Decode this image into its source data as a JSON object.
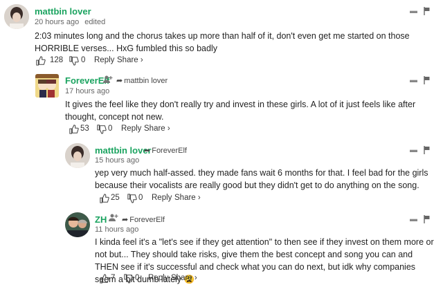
{
  "comments": [
    {
      "name": "mattbin lover",
      "time": "20 hours ago",
      "edited": "edited",
      "text": "2:03 minutes long and the chorus takes up more than half of it, don't even get me started on those HORRIBLE verses... HxG fumbled this so badly",
      "likes": "128",
      "dislikes": "0",
      "reply_label": "Reply",
      "share_label": "Share ›"
    },
    {
      "name": "ForeverElf",
      "reply_to": "mattbin lover",
      "time": "17 hours ago",
      "text": "It gives the feel like they don't really try and invest in these girls. A lot of it just feels like after thought, concept not new.",
      "likes": "53",
      "dislikes": "0",
      "reply_label": "Reply",
      "share_label": "Share ›"
    },
    {
      "name": "mattbin lover",
      "reply_to": "ForeverElf",
      "time": "15 hours ago",
      "text": "yep very much half-assed. they made fans wait 6 months for that. I feel bad for the girls because their vocalists are really good but they didn't get to do anything on the song.",
      "likes": "25",
      "dislikes": "0",
      "reply_label": "Reply",
      "share_label": "Share ›"
    },
    {
      "name": "ZH",
      "reply_to": "ForeverElf",
      "time": "11 hours ago",
      "text": "I kinda feel it's a \"let's see if they get attention\" to then see if they invest on them more or not but... They should take risks, give them the best concept and song you can and THEN see if it's successful and check what you can do next, but idk why companies seem a bit dumb lately 😩",
      "likes": "7",
      "dislikes": "0",
      "reply_label": "Reply",
      "share_label": "Share ›"
    }
  ],
  "icons": {
    "like": "thumbs-up-icon",
    "dislike": "thumbs-down-icon",
    "follow": "user-plus-icon",
    "reply_arrow": "reply-arrow-icon",
    "collapse": "chevron-up-icon",
    "flag": "flag-icon"
  },
  "colors": {
    "username": "#1aa35f",
    "meta": "#666666",
    "text": "#222222"
  }
}
